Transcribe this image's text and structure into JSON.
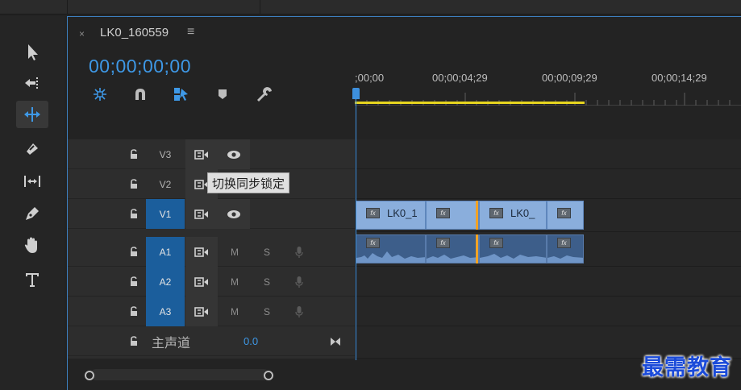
{
  "sequence": {
    "tab_title": "LK0_160559",
    "menu_glyph": "≡",
    "close_glyph": "×",
    "timecode": "00;00;00;00"
  },
  "ruler": {
    "labels": [
      ";00;00",
      "00;00;04;29",
      "00;00;09;29",
      "00;00;14;29"
    ]
  },
  "tracks": {
    "video": [
      {
        "label": "V3",
        "targeted": false
      },
      {
        "label": "V2",
        "targeted": false
      },
      {
        "label": "V1",
        "targeted": true
      }
    ],
    "audio": [
      {
        "label": "A1",
        "m": "M",
        "s": "S"
      },
      {
        "label": "A2",
        "m": "M",
        "s": "S"
      },
      {
        "label": "A3",
        "m": "M",
        "s": "S"
      }
    ],
    "master": {
      "label": "主声道",
      "value": "0.0"
    }
  },
  "tooltip": "切换同步锁定",
  "clips": {
    "v1": [
      "LK0_1",
      "",
      "LK0_",
      ""
    ],
    "fx_label": "fx"
  },
  "watermark": "最需教育",
  "colors": {
    "accent": "#3e98e6",
    "video_clip": "#8aaedc",
    "audio_clip": "#3d5e8a",
    "work_area": "#e6d51f",
    "edit_point": "#f2a325"
  },
  "icons": {
    "tools": [
      "selection-tool-icon",
      "track-select-icon",
      "ripple-edit-icon",
      "razor-icon",
      "slip-icon",
      "pen-icon",
      "hand-icon",
      "type-icon"
    ],
    "controls": [
      "nest-sequence-icon",
      "snap-icon",
      "linked-selection-icon",
      "add-marker-icon",
      "timeline-settings-icon"
    ]
  }
}
